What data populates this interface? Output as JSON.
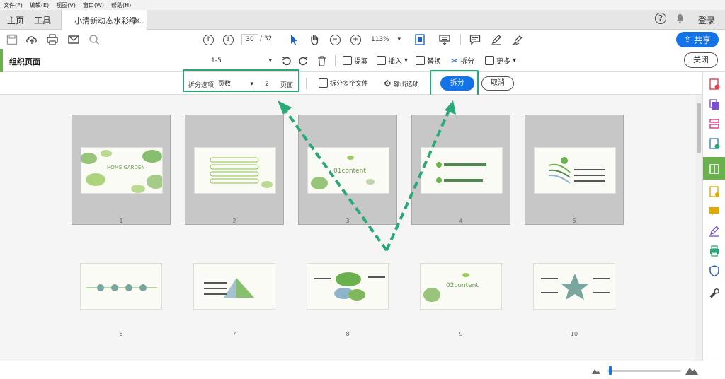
{
  "menu": [
    "文件(F)",
    "编辑(E)",
    "视图(V)",
    "窗口(W)",
    "帮助(H)"
  ],
  "tabs": {
    "home": "主页",
    "tools": "工具",
    "doc": "小清新动态水彩绿...",
    "close": "×"
  },
  "header": {
    "help": "?",
    "login": "登录"
  },
  "toolbar": {
    "current_page": "30",
    "total_pages": "/ 32",
    "zoom": "113%",
    "share": "共享",
    "up": "↑",
    "down": "↓",
    "minus": "−",
    "plus": "+"
  },
  "organize": {
    "title": "组织页面",
    "range": "1-5",
    "extract": "提取",
    "insert": "插入",
    "replace": "替换",
    "split": "拆分",
    "more": "更多",
    "close": "关闭"
  },
  "split_options": {
    "label": "拆分选项",
    "by": "页数",
    "count": "2",
    "unit": "页面",
    "multi": "拆分多个文件",
    "output": "输出选项",
    "split_btn": "拆分",
    "cancel_btn": "取消"
  },
  "thumbnails": [
    {
      "num": "1",
      "text": "HOME GARDEN"
    },
    {
      "num": "2",
      "text": ""
    },
    {
      "num": "3",
      "text": "01content"
    },
    {
      "num": "4",
      "text": ""
    },
    {
      "num": "5",
      "text": ""
    },
    {
      "num": "6",
      "text": ""
    },
    {
      "num": "7",
      "text": ""
    },
    {
      "num": "8",
      "text": ""
    },
    {
      "num": "9",
      "text": "02content"
    },
    {
      "num": "10",
      "text": ""
    }
  ],
  "colors": {
    "accent": "#1473e6",
    "highlight": "#2aa876",
    "leaf": "#6ab04c"
  }
}
